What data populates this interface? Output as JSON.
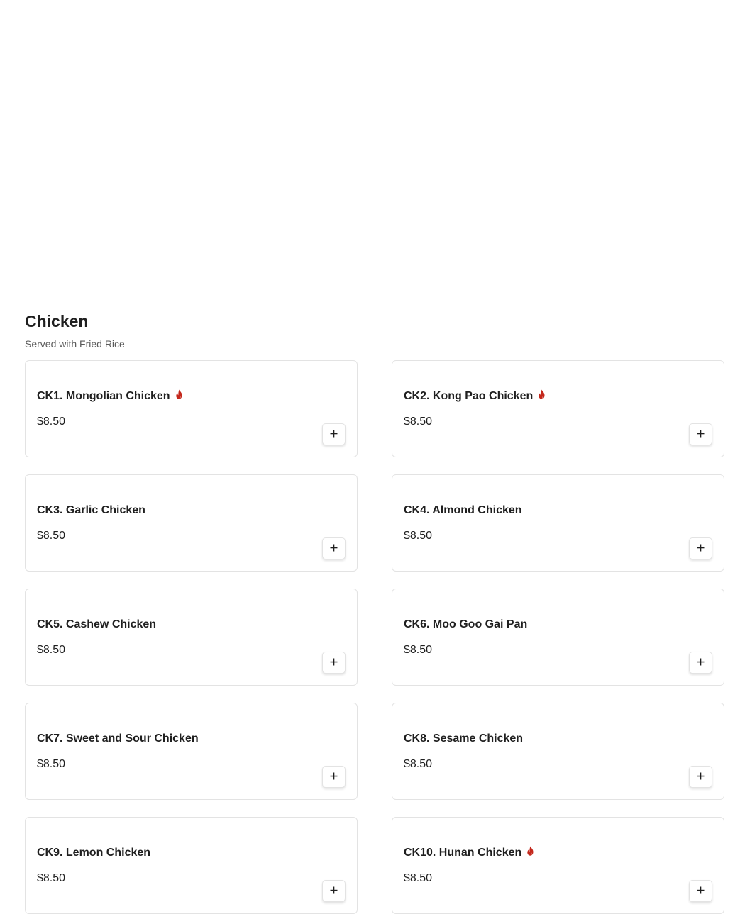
{
  "section": {
    "title": "Chicken",
    "subtitle": "Served with Fried Rice"
  },
  "items": [
    {
      "name": "CK1. Mongolian Chicken",
      "price": "$8.50",
      "spicy": true
    },
    {
      "name": "CK2. Kong Pao Chicken",
      "price": "$8.50",
      "spicy": true
    },
    {
      "name": "CK3. Garlic Chicken",
      "price": "$8.50",
      "spicy": false
    },
    {
      "name": "CK4. Almond Chicken",
      "price": "$8.50",
      "spicy": false
    },
    {
      "name": "CK5. Cashew Chicken",
      "price": "$8.50",
      "spicy": false
    },
    {
      "name": "CK6. Moo Goo Gai Pan",
      "price": "$8.50",
      "spicy": false
    },
    {
      "name": "CK7. Sweet and Sour Chicken",
      "price": "$8.50",
      "spicy": false
    },
    {
      "name": "CK8. Sesame Chicken",
      "price": "$8.50",
      "spicy": false
    },
    {
      "name": "CK9. Lemon Chicken",
      "price": "$8.50",
      "spicy": false
    },
    {
      "name": "CK10. Hunan Chicken",
      "price": "$8.50",
      "spicy": true
    }
  ],
  "icons": {
    "spicy": "flame-icon",
    "add": "plus-icon"
  },
  "colors": {
    "spicy": "#c4281c",
    "text": "#1f1f1f",
    "border": "#e3e3e3"
  }
}
